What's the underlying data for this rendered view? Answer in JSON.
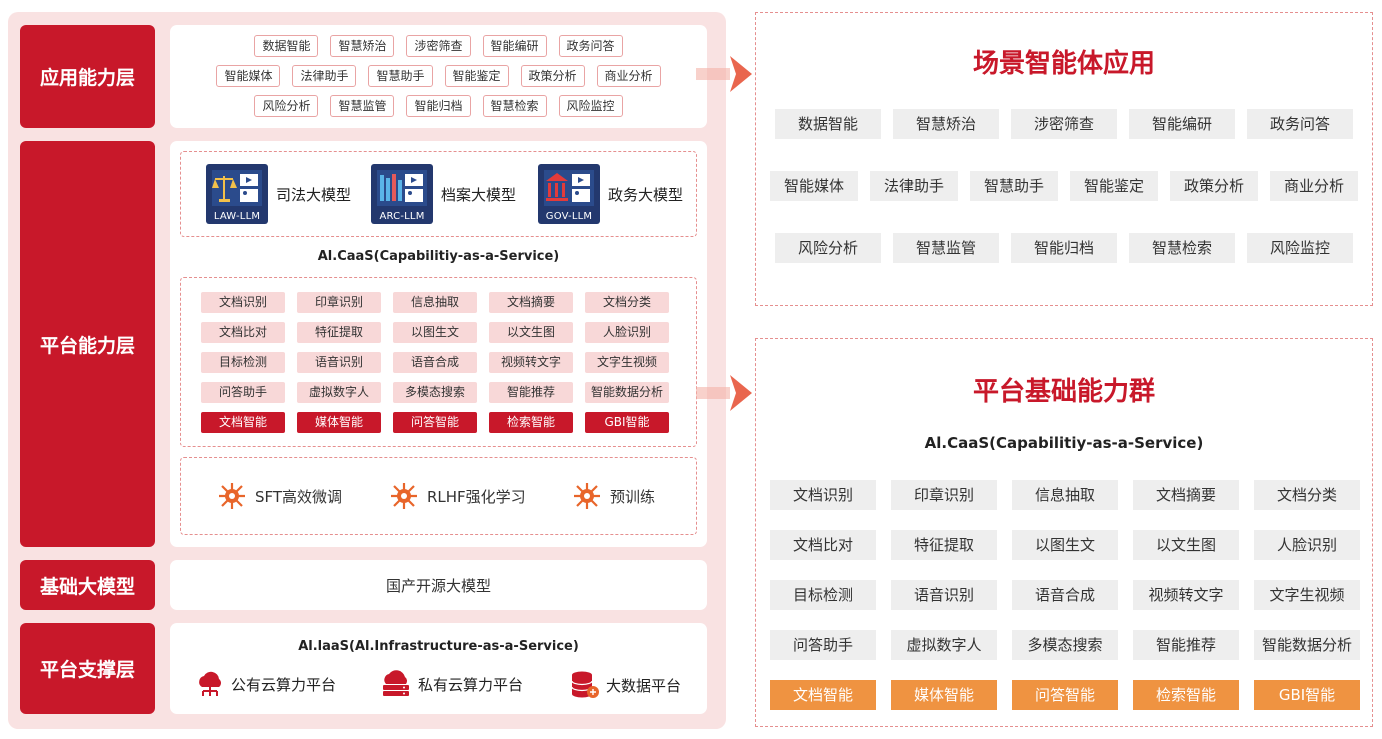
{
  "layers": {
    "app": "应用能力层",
    "platform": "平台能力层",
    "base": "基础大模型",
    "support": "平台支撑层"
  },
  "app_tags": {
    "row1": [
      "数据智能",
      "智慧矫治",
      "涉密筛查",
      "智能编研",
      "政务问答"
    ],
    "row2": [
      "智能媒体",
      "法律助手",
      "智慧助手",
      "智能鉴定",
      "政策分析",
      "商业分析"
    ],
    "row3": [
      "风险分析",
      "智慧监管",
      "智能归档",
      "智慧检索",
      "风险监控"
    ]
  },
  "models": [
    {
      "caption": "LAW-LLM",
      "label": "司法大模型",
      "icon": "scales-icon"
    },
    {
      "caption": "ARC-LLM",
      "label": "档案大模型",
      "icon": "archive-icon"
    },
    {
      "caption": "GOV-LLM",
      "label": "政务大模型",
      "icon": "government-icon"
    }
  ],
  "caas_title": "Al.CaaS(Capabilitiy-as-a-Service)",
  "capabilities": [
    "文档识别",
    "印章识别",
    "信息抽取",
    "文档摘要",
    "文档分类",
    "文档比对",
    "特征提取",
    "以图生文",
    "以文生图",
    "人脸识别",
    "目标检测",
    "语音识别",
    "语音合成",
    "视频转文字",
    "文字生视频",
    "问答助手",
    "虚拟数字人",
    "多模态搜索",
    "智能推荐",
    "智能数据分析"
  ],
  "capability_highlights": [
    "文档智能",
    "媒体智能",
    "问答智能",
    "检索智能",
    "GBI智能"
  ],
  "training": [
    "SFT高效微调",
    "RLHF强化学习",
    "预训练"
  ],
  "base_model": "国产开源大模型",
  "iaas_title": "Al.laaS(Al.Infrastructure-as-a-Service)",
  "infra": [
    {
      "label": "公有云算力平台",
      "icon": "public-cloud-icon"
    },
    {
      "label": "私有云算力平台",
      "icon": "private-cloud-icon"
    },
    {
      "label": "大数据平台",
      "icon": "database-icon"
    }
  ],
  "right_top": {
    "title": "场景智能体应用",
    "row1": [
      "数据智能",
      "智慧矫治",
      "涉密筛查",
      "智能编研",
      "政务问答"
    ],
    "row2": [
      "智能媒体",
      "法律助手",
      "智慧助手",
      "智能鉴定",
      "政策分析",
      "商业分析"
    ],
    "row3": [
      "风险分析",
      "智慧监管",
      "智能归档",
      "智慧检索",
      "风险监控"
    ]
  },
  "right_bottom": {
    "title": "平台基础能力群",
    "subtitle": "Al.CaaS(Capabilitiy-as-a-Service)"
  },
  "colors": {
    "brand_red": "#c8182a",
    "accent_orange": "#ef9341",
    "panel_pink": "#f9e2e2"
  }
}
